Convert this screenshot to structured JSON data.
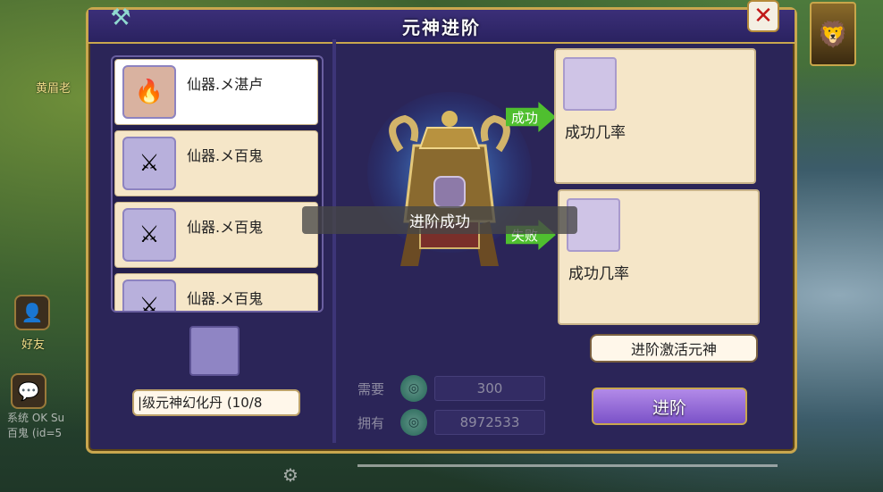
{
  "background": {
    "npc_label_left": "黄眉老",
    "friends_label": "好友",
    "chat_lines": [
      "系统 OK Su",
      "百鬼 (id=5"
    ]
  },
  "window": {
    "title": "元神进阶",
    "close_icon": "close-icon"
  },
  "item_list": [
    {
      "name": "仙器.メ湛卢",
      "icon": "flame-feather-icon",
      "selected": true
    },
    {
      "name": "仙器.メ百鬼",
      "icon": "dark-knight-icon",
      "selected": false
    },
    {
      "name": "仙器.メ百鬼",
      "icon": "dark-knight-icon",
      "selected": false
    },
    {
      "name": "仙器.メ百鬼",
      "icon": "dark-knight-icon",
      "selected": false
    }
  ],
  "material": {
    "label": "|级元神幻化丹 (10/8"
  },
  "altar": {
    "success_arrow": "成功",
    "fail_arrow": "失败"
  },
  "results": {
    "success_text": "成功几率",
    "fail_text": "成功几率"
  },
  "toast": "进阶成功",
  "buttons": {
    "activate": "进阶激活元神",
    "advance": "进阶"
  },
  "costs": [
    {
      "label": "需要",
      "value": "300"
    },
    {
      "label": "拥有",
      "value": "8972533"
    }
  ],
  "colors": {
    "panel_bg": "#2b2558",
    "gold_border": "#c9a74e",
    "card_bg": "#f5e6c8",
    "arrow_green": "#4fbf2f",
    "advance_button": "#9a6fdc"
  }
}
